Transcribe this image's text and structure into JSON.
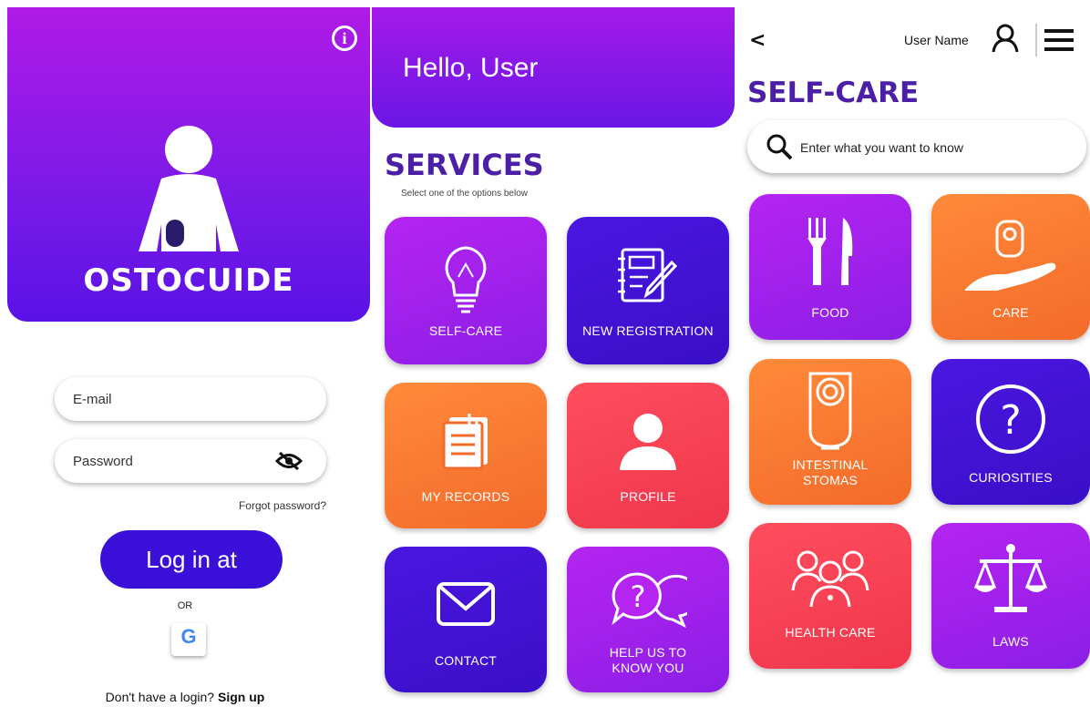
{
  "login": {
    "brand": "OSTOCUIDE",
    "email_placeholder": "E-mail",
    "password_placeholder": "Password",
    "forgot": "Forgot password?",
    "login_button": "Log in at",
    "or": "OR",
    "google_letter": "G",
    "signup_prompt": "Don't have a login?",
    "signup_link": "Sign up"
  },
  "services": {
    "greeting": "Hello, User",
    "title": "SERVICES",
    "subtitle": "Select one of the options below",
    "tiles": [
      {
        "label": "SELF-CARE",
        "icon": "lightbulb-icon"
      },
      {
        "label": "NEW REGISTRATION",
        "icon": "notebook-icon"
      },
      {
        "label": "MY RECORDS",
        "icon": "documents-icon"
      },
      {
        "label": "PROFILE",
        "icon": "person-icon"
      },
      {
        "label": "CONTACT",
        "icon": "envelope-icon"
      },
      {
        "label": "HELP US TO\nKNOW YOU",
        "icon": "chat-question-icon"
      }
    ]
  },
  "selfcare": {
    "back": "<",
    "user_name": "User Name",
    "title": "SELF-CARE",
    "search_placeholder": "Enter what you want to know",
    "tiles": [
      {
        "label": "FOOD",
        "icon": "fork-knife-icon"
      },
      {
        "label": "CARE",
        "icon": "hand-pouch-icon"
      },
      {
        "label": "INTESTINAL\nSTOMAS",
        "icon": "stoma-bag-icon"
      },
      {
        "label": "CURIOSITIES",
        "icon": "question-circle-icon"
      },
      {
        "label": "HEALTH CARE",
        "icon": "people-group-icon"
      },
      {
        "label": "LAWS",
        "icon": "scales-icon"
      }
    ]
  },
  "colors": {
    "purple": "#a51ff0",
    "indigo": "#4a16e0",
    "orange": "#f97a32",
    "red": "#f4404f",
    "title": "#4b1fa6"
  }
}
